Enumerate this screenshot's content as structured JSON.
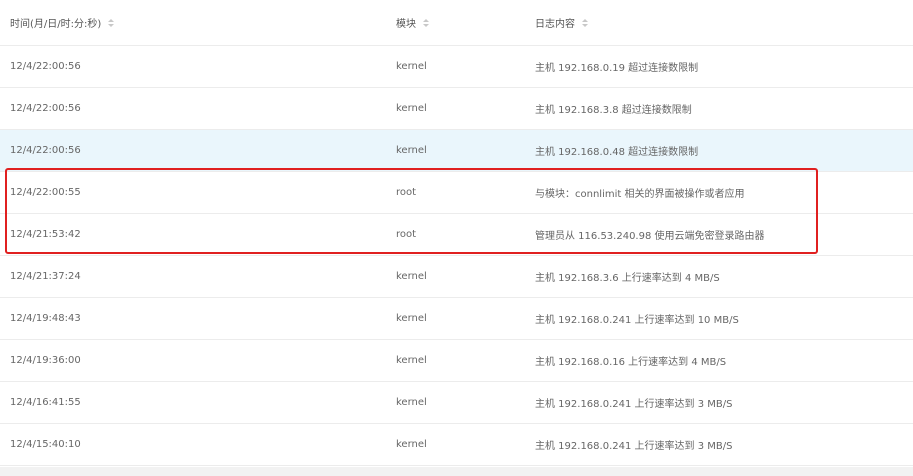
{
  "table": {
    "columns": {
      "time": "时间(月/日/时:分:秒)",
      "module": "模块",
      "content": "日志内容"
    },
    "rows": [
      {
        "time": "12/4/22:00:56",
        "module": "kernel",
        "content": "主机 192.168.0.19 超过连接数限制"
      },
      {
        "time": "12/4/22:00:56",
        "module": "kernel",
        "content": "主机 192.168.3.8 超过连接数限制"
      },
      {
        "time": "12/4/22:00:56",
        "module": "kernel",
        "content": "主机 192.168.0.48 超过连接数限制"
      },
      {
        "time": "12/4/22:00:55",
        "module": "root",
        "content": "与模块：connlimit 相关的界面被操作或者应用"
      },
      {
        "time": "12/4/21:53:42",
        "module": "root",
        "content": "管理员从 116.53.240.98 使用云端免密登录路由器"
      },
      {
        "time": "12/4/21:37:24",
        "module": "kernel",
        "content": "主机 192.168.3.6 上行速率达到 4 MB/S"
      },
      {
        "time": "12/4/19:48:43",
        "module": "kernel",
        "content": "主机 192.168.0.241 上行速率达到 10 MB/S"
      },
      {
        "time": "12/4/19:36:00",
        "module": "kernel",
        "content": "主机 192.168.0.16 上行速率达到 4 MB/S"
      },
      {
        "time": "12/4/16:41:55",
        "module": "kernel",
        "content": "主机 192.168.0.241 上行速率达到 3 MB/S"
      },
      {
        "time": "12/4/15:40:10",
        "module": "kernel",
        "content": "主机 192.168.0.241 上行速率达到 3 MB/S"
      }
    ]
  },
  "colors": {
    "highlight_row": "#eaf6fc",
    "selection_border": "#e02020"
  },
  "icons": {
    "sort": "sort-icon"
  }
}
